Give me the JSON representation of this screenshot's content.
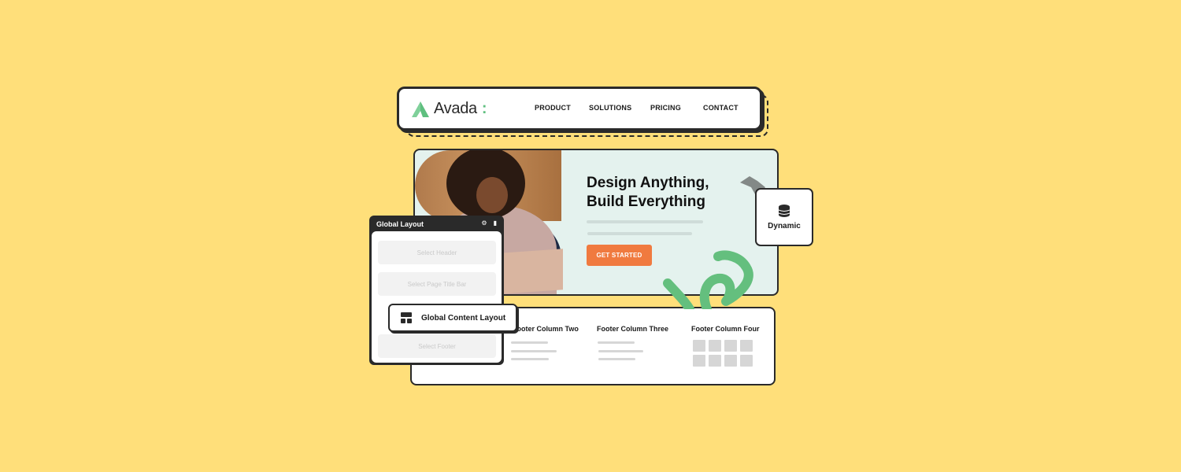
{
  "header": {
    "logo_text": "Avada",
    "logo_colon": ":",
    "nav": [
      "PRODUCT",
      "SOLUTIONS",
      "PRICING",
      "CONTACT"
    ]
  },
  "hero": {
    "title_line1": "Design Anything,",
    "title_line2": "Build Everything",
    "cta_label": "GET STARTED",
    "photo_icon": "person-with-laptop-photo"
  },
  "dynamic_card": {
    "icon": "database-icon",
    "label": "Dynamic"
  },
  "global_layout": {
    "title": "Global Layout",
    "icons": [
      "gear-icon",
      "trash-icon"
    ],
    "slots": [
      "Select Header",
      "Select Page Title Bar",
      "Select Footer"
    ],
    "content_layout_label": "Global Content Layout",
    "content_layout_icon": "layout-grid-icon"
  },
  "footer": {
    "columns": [
      "Footer Column Two",
      "Footer Column Three",
      "Footer Column Four"
    ]
  },
  "colors": {
    "background": "#ffdf7a",
    "accent_green": "#5fbf7f",
    "cta_orange": "#f07a3f",
    "hero_bg": "#e4f2ee",
    "border_dark": "#2a2a2a"
  }
}
